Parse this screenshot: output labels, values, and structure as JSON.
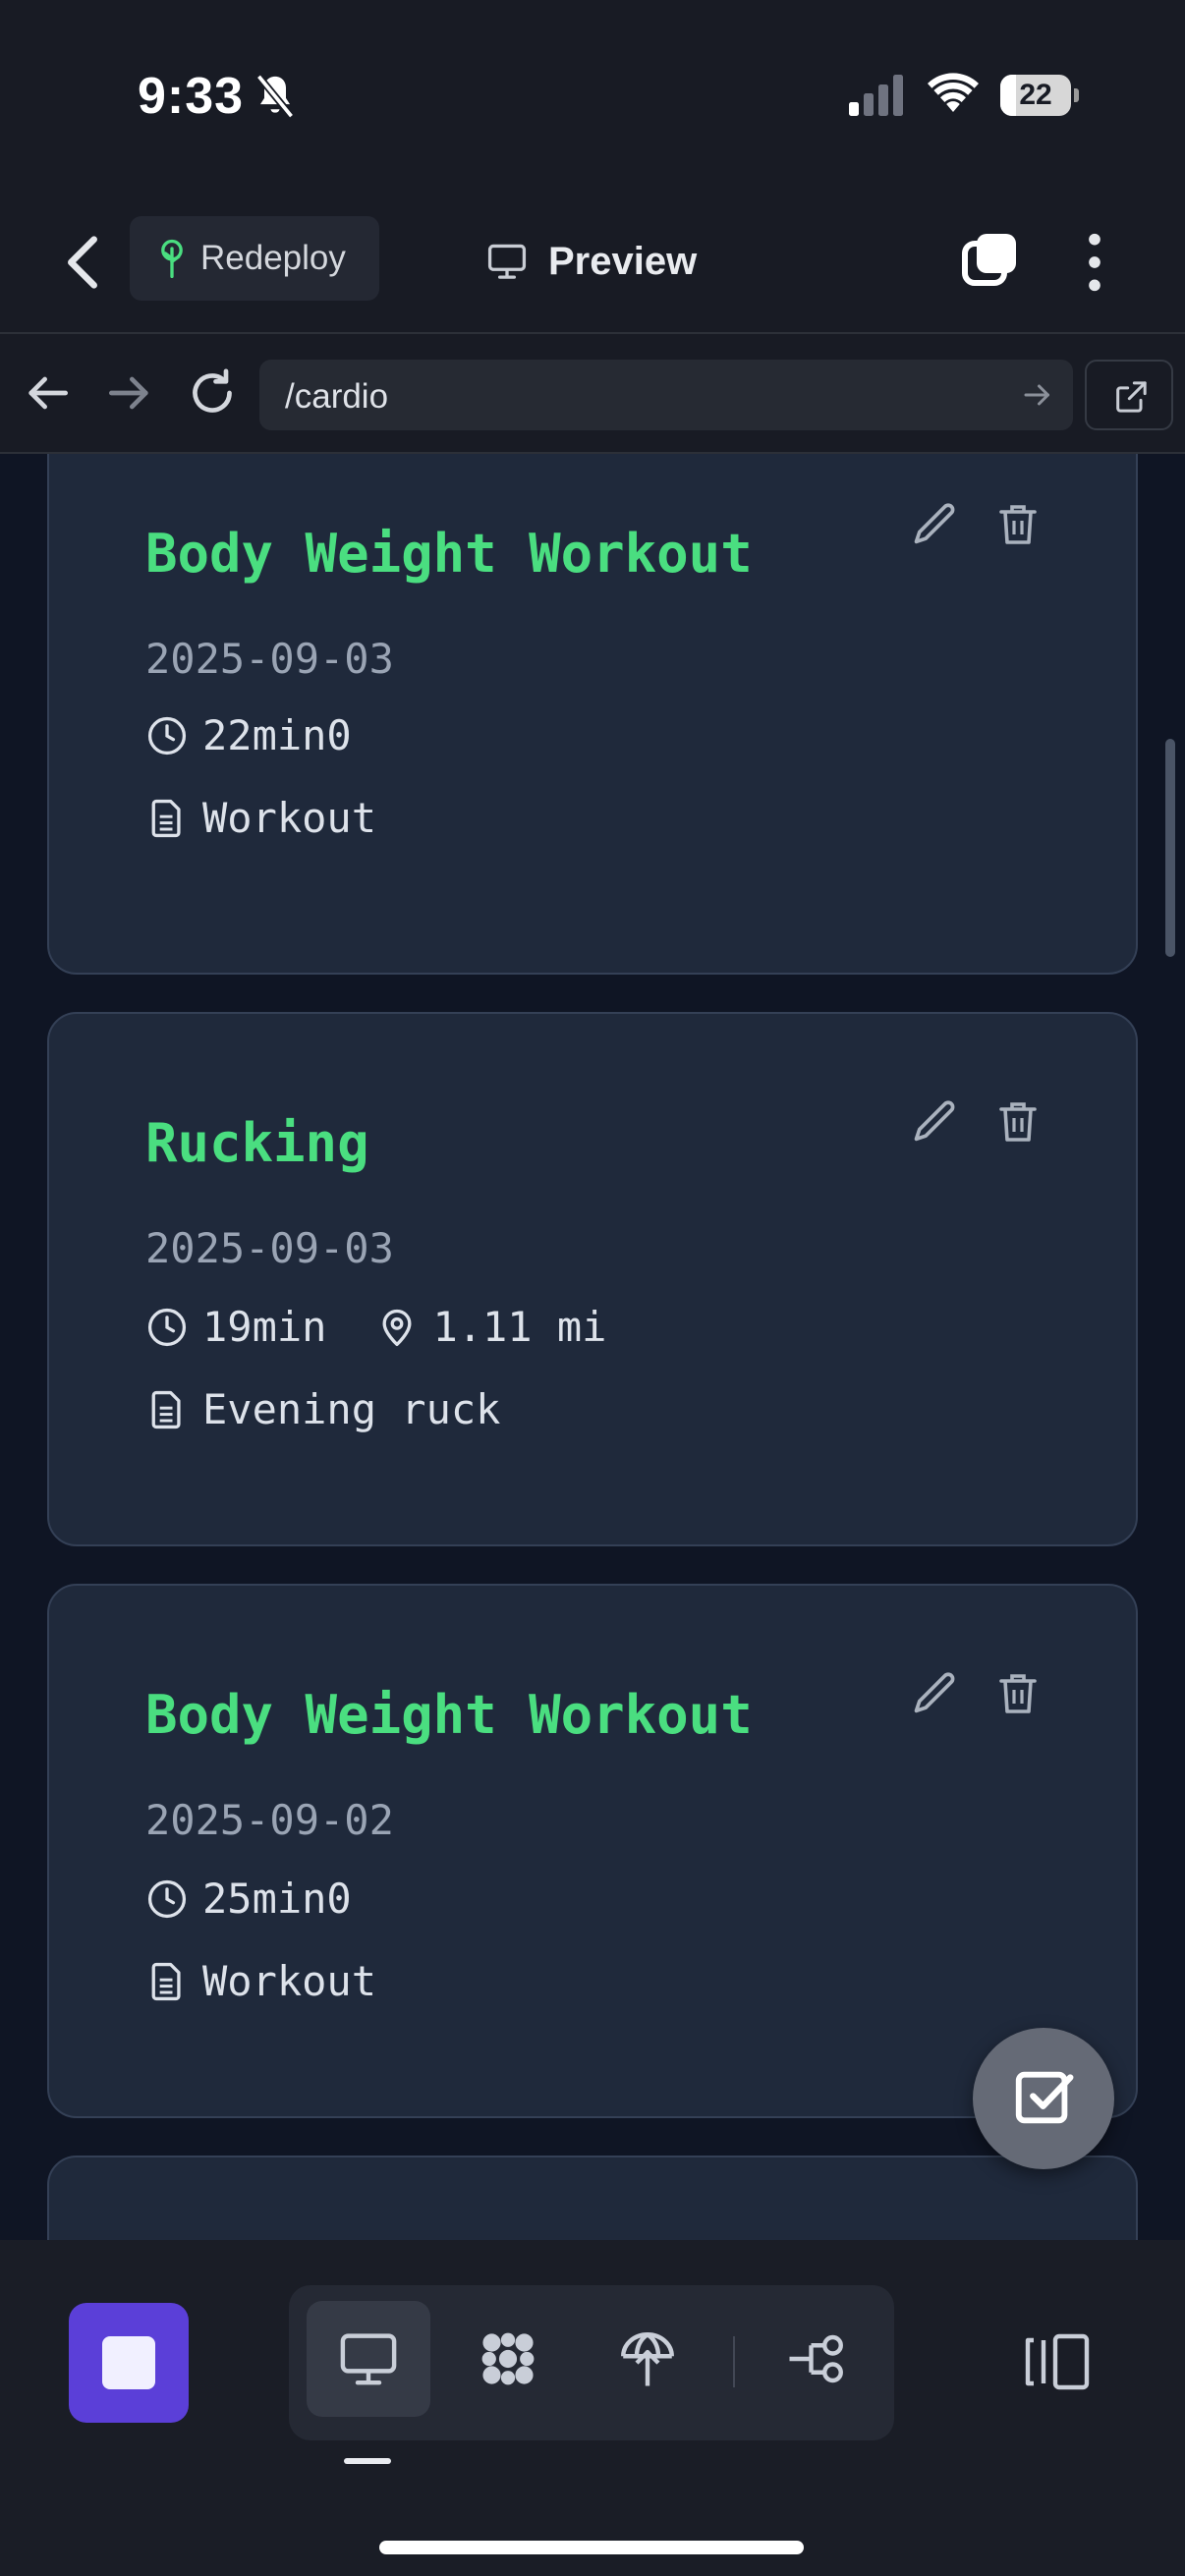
{
  "status_bar": {
    "time": "9:33",
    "battery": "22",
    "battery_level": 0.22
  },
  "header": {
    "redeploy_label": "Redeploy",
    "preview_label": "Preview"
  },
  "browser": {
    "url": "/cardio"
  },
  "cards": [
    {
      "title": "Body Weight Workout",
      "date": "2025-09-03",
      "duration": "22min0",
      "distance": "",
      "note": "Workout"
    },
    {
      "title": "Rucking",
      "date": "2025-09-03",
      "duration": "19min",
      "distance": "1.11 mi",
      "note": "Evening ruck"
    },
    {
      "title": "Body Weight Workout",
      "date": "2025-09-02",
      "duration": "25min0",
      "distance": "",
      "note": "Workout"
    }
  ],
  "icons": {
    "status": [
      "bell-slash-icon",
      "cellular-signal-icon",
      "wifi-icon",
      "battery-icon"
    ],
    "header": [
      "chevron-left-icon",
      "tree-icon",
      "monitor-icon",
      "windows-icon",
      "more-vertical-icon"
    ],
    "browser": [
      "arrow-left-icon",
      "arrow-right-icon",
      "reload-icon",
      "arrow-right-icon",
      "external-link-icon"
    ],
    "card": [
      "clock-icon",
      "map-pin-icon",
      "document-icon",
      "pencil-icon",
      "trash-icon"
    ],
    "toolbar": [
      "stop-icon",
      "monitor-icon",
      "apps-icon",
      "deploy-icon",
      "workflow-icon",
      "side-panel-icon"
    ],
    "fab": "checkbox-icon"
  },
  "colors": {
    "title_green": "#4ade80",
    "card_bg": "#1f293b",
    "page_bg": "#0f1524",
    "stop_purple": "#5b3fd8"
  }
}
